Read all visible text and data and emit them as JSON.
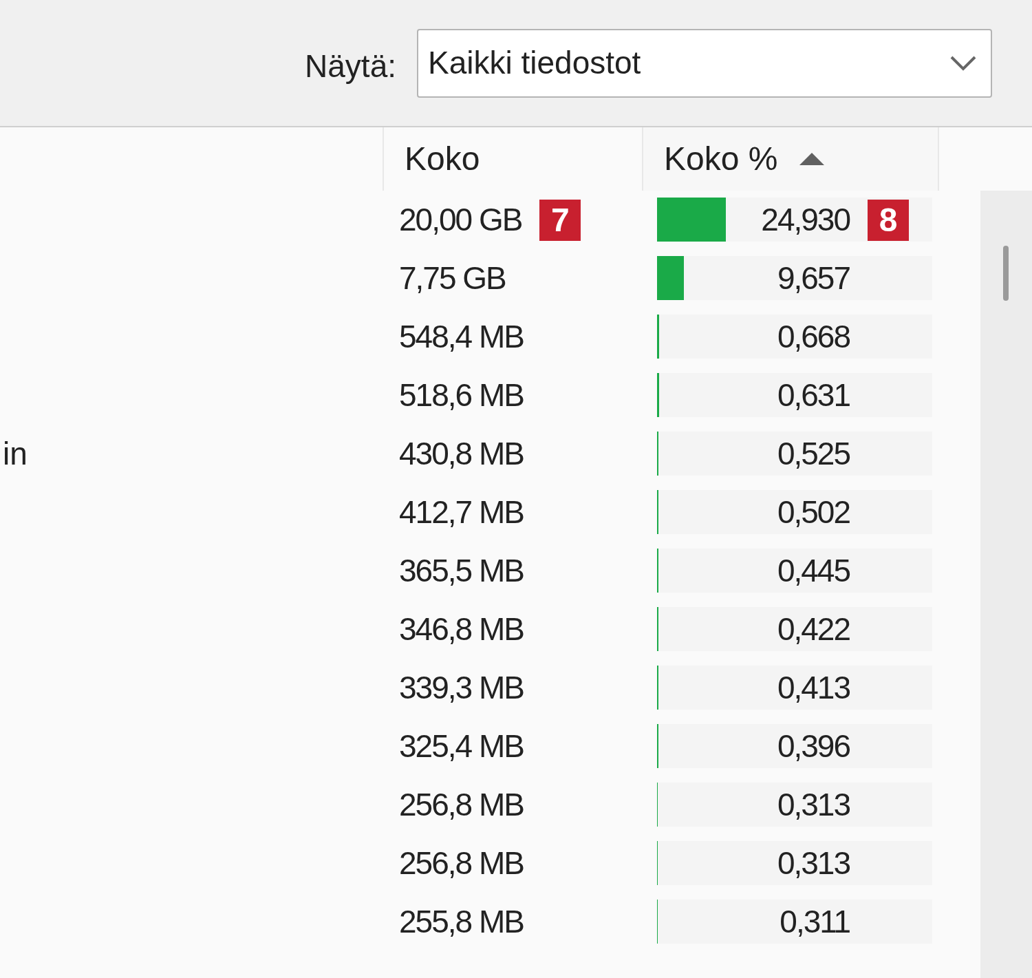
{
  "filter": {
    "label": "Näytä:",
    "value": "Kaikki tiedostot"
  },
  "table": {
    "columns": [
      {
        "label": "Koko",
        "sorted": false
      },
      {
        "label": "Koko %",
        "sorted": true
      }
    ],
    "rows": [
      {
        "size": "20,00 GB",
        "percent": "24,930",
        "level": 0.2493,
        "size_callout": "7",
        "percent_callout": "8"
      },
      {
        "size": "7,75 GB",
        "percent": "9,657",
        "level": 0.0966
      },
      {
        "size": "548,4 MB",
        "percent": "0,668",
        "level": 0.0067
      },
      {
        "size": "518,6 MB",
        "percent": "0,631",
        "level": 0.0063
      },
      {
        "name": "in",
        "size": "430,8 MB",
        "percent": "0,525",
        "level": 0.0053
      },
      {
        "size": "412,7 MB",
        "percent": "0,502",
        "level": 0.005
      },
      {
        "size": "365,5 MB",
        "percent": "0,445",
        "level": 0.0045
      },
      {
        "size": "346,8 MB",
        "percent": "0,422",
        "level": 0.0042
      },
      {
        "size": "339,3 MB",
        "percent": "0,413",
        "level": 0.0041
      },
      {
        "size": "325,4 MB",
        "percent": "0,396",
        "level": 0.004
      },
      {
        "size": "256,8 MB",
        "percent": "0,313",
        "level": 0.0031
      },
      {
        "size": "256,8 MB",
        "percent": "0,313",
        "level": 0.0031
      },
      {
        "size": "255,8 MB",
        "percent": "0,311",
        "level": 0.0031
      }
    ]
  }
}
